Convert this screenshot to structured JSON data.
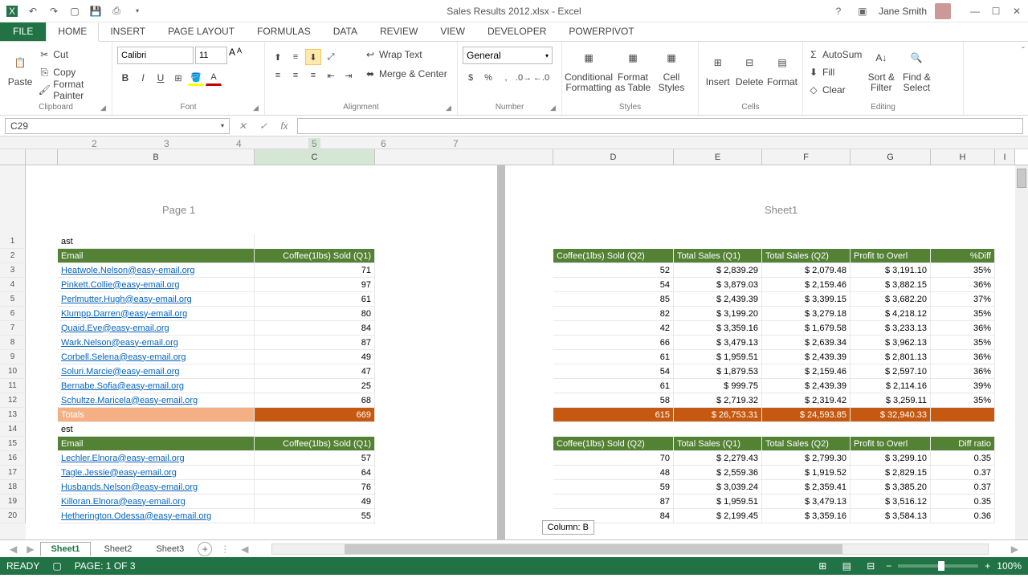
{
  "title": "Sales Results 2012.xlsx - Excel",
  "user": "Jane Smith",
  "ribbon_tabs": [
    "FILE",
    "HOME",
    "INSERT",
    "PAGE LAYOUT",
    "FORMULAS",
    "DATA",
    "REVIEW",
    "VIEW",
    "DEVELOPER",
    "POWERPIVOT"
  ],
  "active_tab": "HOME",
  "clipboard": {
    "paste": "Paste",
    "cut": "Cut",
    "copy": "Copy",
    "format_painter": "Format Painter",
    "label": "Clipboard"
  },
  "font": {
    "name": "Calibri",
    "size": "11",
    "label": "Font"
  },
  "alignment": {
    "wrap": "Wrap Text",
    "merge": "Merge & Center",
    "label": "Alignment"
  },
  "number": {
    "format": "General",
    "label": "Number"
  },
  "styles": {
    "cond": "Conditional Formatting",
    "table": "Format as Table",
    "cell": "Cell Styles",
    "label": "Styles"
  },
  "cells": {
    "insert": "Insert",
    "delete": "Delete",
    "format": "Format",
    "label": "Cells"
  },
  "editing": {
    "sum": "AutoSum",
    "fill": "Fill",
    "clear": "Clear",
    "sort": "Sort & Filter",
    "find": "Find & Select",
    "label": "Editing"
  },
  "name_box": "C29",
  "columns": [
    "B",
    "C",
    "D",
    "E",
    "F",
    "G",
    "H",
    "I"
  ],
  "page1": "Page 1",
  "sheet_label": "Sheet1",
  "hdr": {
    "email": "Email",
    "q1": "Coffee(1lbs) Sold (Q1)",
    "q2": "Coffee(1lbs) Sold (Q2)",
    "s1": "Total Sales (Q1)",
    "s2": "Total Sales (Q2)",
    "profit": "Profit to Overl",
    "pdiff": "%Diff",
    "diffr": "Diff ratio"
  },
  "rows1": [
    {
      "email": "Heatwole.Nelson@easy-email.org",
      "q1": 71,
      "q2": 52,
      "s1": "2,839.29",
      "s2": "2,079.48",
      "p": "3,191.10",
      "d": "35%"
    },
    {
      "email": "Pinkett.Collie@easy-email.org",
      "q1": 97,
      "q2": 54,
      "s1": "3,879.03",
      "s2": "2,159.46",
      "p": "3,882.15",
      "d": "36%"
    },
    {
      "email": "Perlmutter.Hugh@easy-email.org",
      "q1": 61,
      "q2": 85,
      "s1": "2,439.39",
      "s2": "3,399.15",
      "p": "3,682.20",
      "d": "37%"
    },
    {
      "email": "Klumpp.Darren@easy-email.org",
      "q1": 80,
      "q2": 82,
      "s1": "3,199.20",
      "s2": "3,279.18",
      "p": "4,218.12",
      "d": "35%"
    },
    {
      "email": "Quaid.Eve@easy-email.org",
      "q1": 84,
      "q2": 42,
      "s1": "3,359.16",
      "s2": "1,679.58",
      "p": "3,233.13",
      "d": "36%"
    },
    {
      "email": "Wark.Nelson@easy-email.org",
      "q1": 87,
      "q2": 66,
      "s1": "3,479.13",
      "s2": "2,639.34",
      "p": "3,962.13",
      "d": "35%"
    },
    {
      "email": "Corbell.Selena@easy-email.org",
      "q1": 49,
      "q2": 61,
      "s1": "1,959.51",
      "s2": "2,439.39",
      "p": "2,801.13",
      "d": "36%"
    },
    {
      "email": "Soluri.Marcie@easy-email.org",
      "q1": 47,
      "q2": 54,
      "s1": "1,879.53",
      "s2": "2,159.46",
      "p": "2,597.10",
      "d": "36%"
    },
    {
      "email": "Bernabe.Sofia@easy-email.org",
      "q1": 25,
      "q2": 61,
      "s1": "999.75",
      "s2": "2,439.39",
      "p": "2,114.16",
      "d": "39%"
    },
    {
      "email": "Schultze.Maricela@easy-email.org",
      "q1": 68,
      "q2": 58,
      "s1": "2,719.32",
      "s2": "2,319.42",
      "p": "3,259.11",
      "d": "35%"
    }
  ],
  "totals": {
    "label": "Totals",
    "q1": 669,
    "q2": 615,
    "s1": "26,753.31",
    "s2": "24,593.85",
    "p": "$ 32,940.33"
  },
  "rows2": [
    {
      "email": "Lechler.Elnora@easy-email.org",
      "q1": 57,
      "q2": 70,
      "s1": "2,279.43",
      "s2": "2,799.30",
      "p": "3,299.10",
      "d": "0.35"
    },
    {
      "email": "Tagle.Jessie@easy-email.org",
      "q1": 64,
      "q2": 48,
      "s1": "2,559.36",
      "s2": "1,919.52",
      "p": "2,829.15",
      "d": "0.37"
    },
    {
      "email": "Husbands.Nelson@easy-email.org",
      "q1": 76,
      "q2": 59,
      "s1": "3,039.24",
      "s2": "2,359.41",
      "p": "3,385.20",
      "d": "0.37"
    },
    {
      "email": "Killoran.Elnora@easy-email.org",
      "q1": 49,
      "q2": 87,
      "s1": "1,959.51",
      "s2": "3,479.13",
      "p": "3,516.12",
      "d": "0.35"
    },
    {
      "email": "Hetherington.Odessa@easy-email.org",
      "q1": 55,
      "q2": 84,
      "s1": "2,199.45",
      "s2": "3,359.16",
      "p": "3,584.13",
      "d": "0.36"
    }
  ],
  "ast": "ast",
  "est": "est",
  "tooltip": "Column: B",
  "sheets": [
    "Sheet1",
    "Sheet2",
    "Sheet3"
  ],
  "status": {
    "ready": "READY",
    "page": "PAGE: 1 OF 3",
    "zoom": "100%"
  }
}
